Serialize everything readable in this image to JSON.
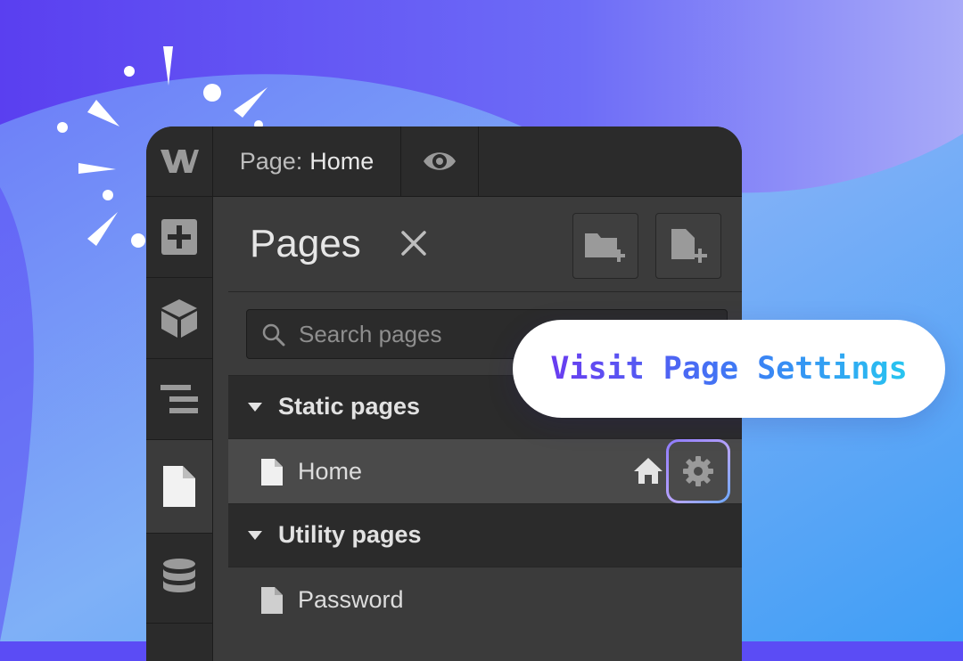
{
  "colors": {
    "background_purple": "#5b4cf5",
    "background_blue": "#4aa6f7",
    "app_dark": "#2b2b2b",
    "panel": "#3b3b3b",
    "selected_row": "#4a4a4a",
    "callout_gradient_start": "#6a3cf0",
    "callout_gradient_end": "#27c6f0"
  },
  "topbar": {
    "logo_icon": "webflow-logo-icon",
    "page_prefix": "Page:",
    "page_name": "Home",
    "preview_icon": "eye-icon"
  },
  "leftbar": {
    "items": [
      {
        "icon": "add-icon"
      },
      {
        "icon": "cube-icon"
      },
      {
        "icon": "navigator-icon"
      },
      {
        "icon": "page-icon",
        "active": true
      },
      {
        "icon": "database-icon"
      }
    ]
  },
  "pages_panel": {
    "title": "Pages",
    "close_icon": "close-icon",
    "new_folder_icon": "new-folder-icon",
    "new_page_icon": "new-page-icon",
    "search": {
      "placeholder": "Search pages",
      "value": ""
    },
    "sections": [
      {
        "label": "Static pages",
        "pages": [
          {
            "label": "Home",
            "is_home": true,
            "selected": true
          }
        ]
      },
      {
        "label": "Utility pages",
        "pages": [
          {
            "label": "Password"
          }
        ]
      }
    ]
  },
  "callout": {
    "text": "Visit Page Settings"
  }
}
